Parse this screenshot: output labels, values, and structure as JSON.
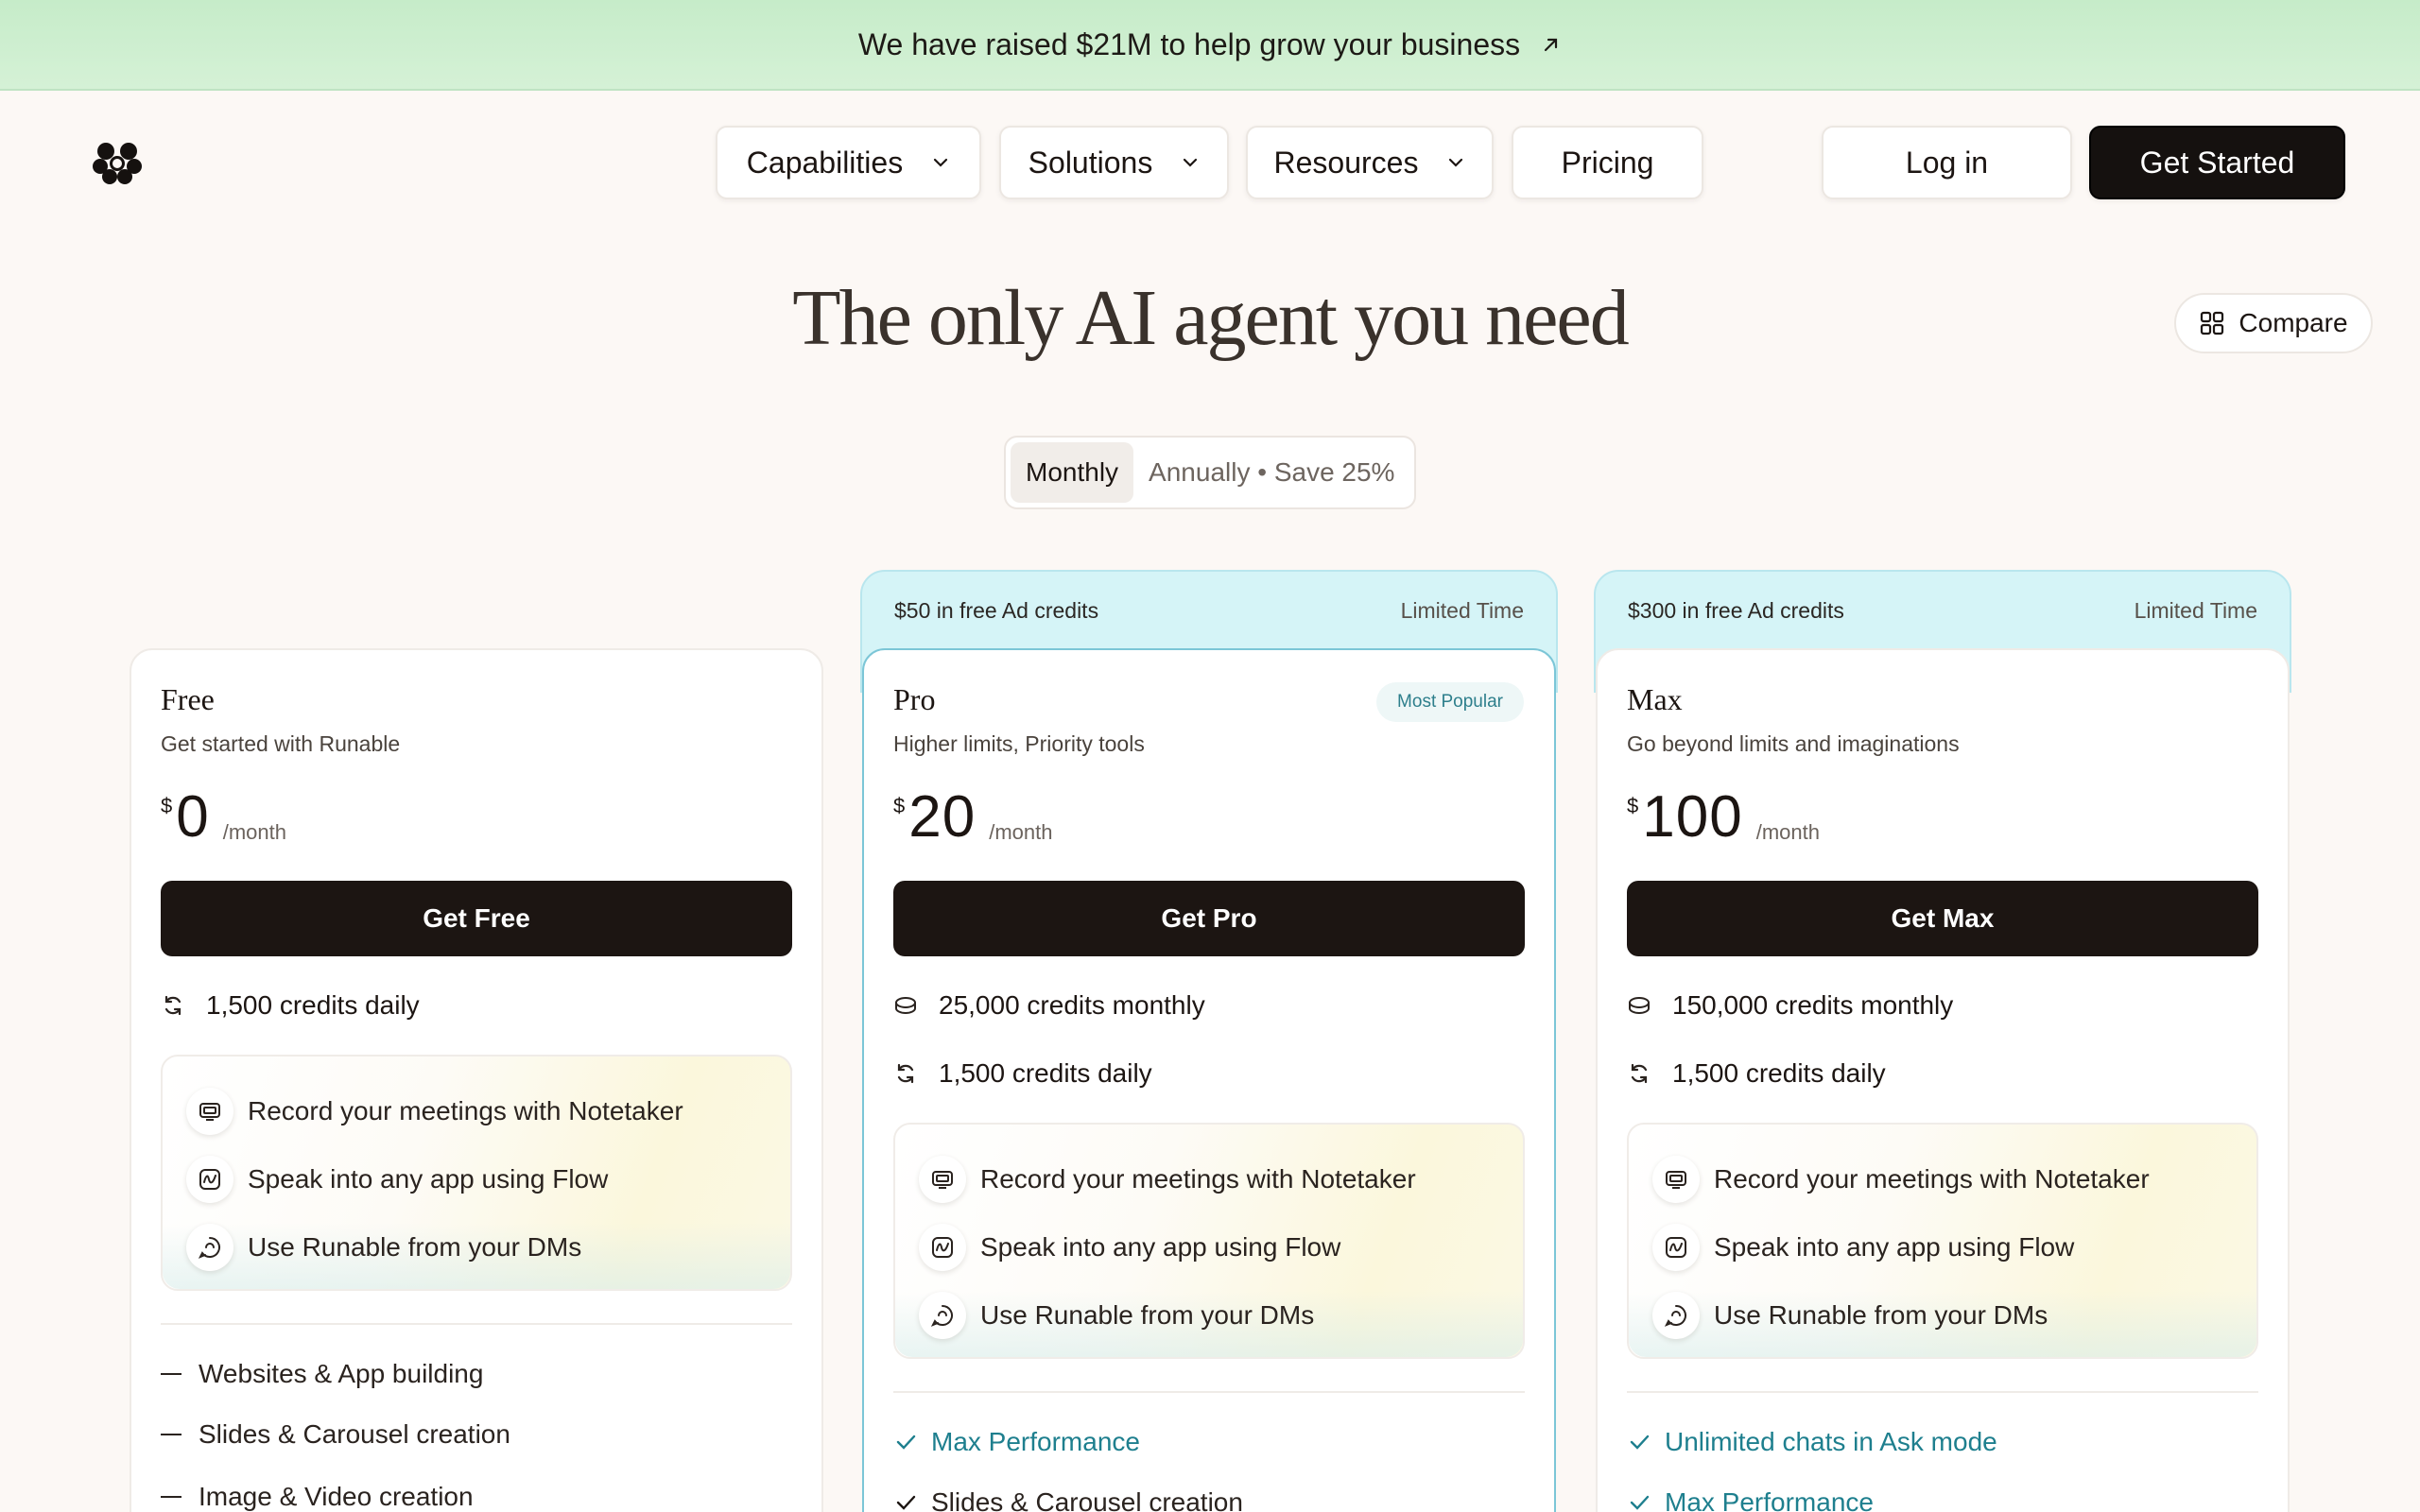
{
  "announcement": {
    "text": "We have raised $21M to help grow your business"
  },
  "nav": {
    "capabilities": "Capabilities",
    "solutions": "Solutions",
    "resources": "Resources",
    "pricing": "Pricing",
    "login": "Log in",
    "get_started": "Get Started"
  },
  "hero": {
    "title": "The only AI agent you need"
  },
  "compare": {
    "label": "Compare"
  },
  "billing": {
    "monthly": "Monthly",
    "annually": "Annually • Save 25%",
    "selected": "Monthly"
  },
  "colors": {
    "background": "#fcf8f5",
    "banner": "#c6ecc9",
    "promo": "#d5f4f7",
    "accent": "#1e7f8e",
    "dark": "#1c1512"
  },
  "plans": {
    "free": {
      "name": "Free",
      "subtitle": "Get started with Runable",
      "currency": "$",
      "price": "0",
      "period": "/month",
      "cta": "Get Free",
      "credits": [
        "1,500 credits daily"
      ],
      "features": [
        "Record your meetings with Notetaker",
        "Speak into any app using Flow",
        "Use Runable from your DMs"
      ],
      "list": [
        "Websites & App building",
        "Slides & Carousel creation",
        "Image & Video creation"
      ]
    },
    "pro": {
      "promo": "$50 in free Ad credits",
      "promo_tag": "Limited Time",
      "name": "Pro",
      "badge": "Most Popular",
      "subtitle": "Higher limits, Priority tools",
      "currency": "$",
      "price": "20",
      "period": "/month",
      "cta": "Get Pro",
      "credits": [
        "25,000 credits monthly",
        "1,500 credits daily"
      ],
      "features": [
        "Record your meetings with Notetaker",
        "Speak into any app using Flow",
        "Use Runable from your DMs"
      ],
      "list": [
        "Max Performance",
        "Slides & Carousel creation"
      ]
    },
    "max": {
      "promo": "$300 in free Ad credits",
      "promo_tag": "Limited Time",
      "name": "Max",
      "subtitle": "Go beyond limits and imaginations",
      "currency": "$",
      "price": "100",
      "period": "/month",
      "cta": "Get Max",
      "credits": [
        "150,000 credits monthly",
        "1,500 credits daily"
      ],
      "features": [
        "Record your meetings with Notetaker",
        "Speak into any app using Flow",
        "Use Runable from your DMs"
      ],
      "list": [
        "Unlimited chats in Ask mode",
        "Max Performance"
      ]
    }
  }
}
